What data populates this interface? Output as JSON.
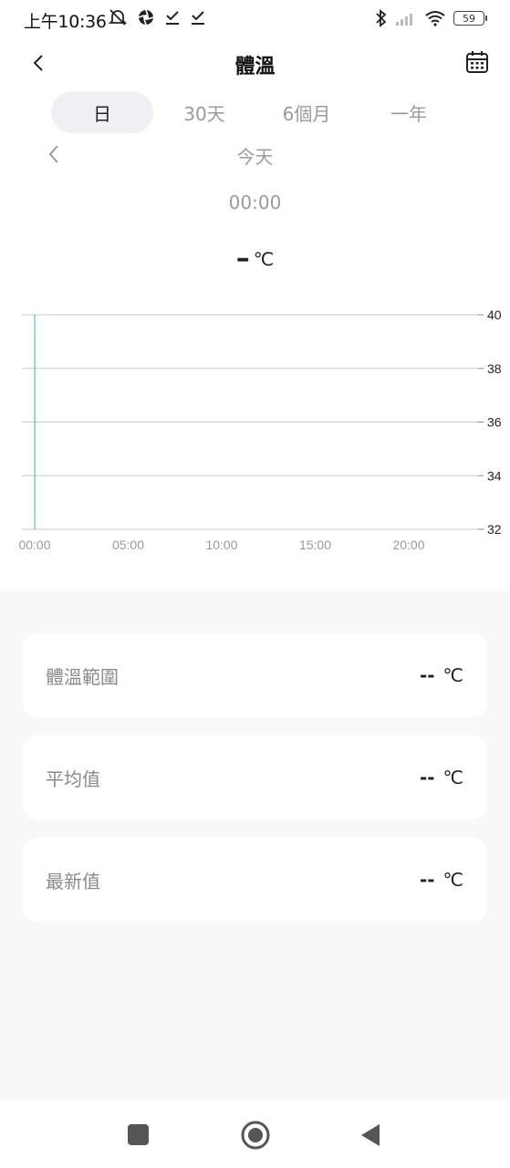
{
  "status_bar": {
    "time": "上午10:36",
    "battery": "59",
    "icons": [
      "mute-bell-icon",
      "aperture-icon",
      "check-download-icon",
      "check-download-icon",
      "bluetooth-icon",
      "signal-icon",
      "wifi-icon",
      "battery-icon"
    ]
  },
  "header": {
    "title": "體溫",
    "back_icon": "chevron-left-icon",
    "calendar_icon": "calendar-icon"
  },
  "tabs": [
    {
      "label": "日",
      "active": true
    },
    {
      "label": "30天",
      "active": false
    },
    {
      "label": "6個月",
      "active": false
    },
    {
      "label": "一年",
      "active": false
    }
  ],
  "date_nav": {
    "label": "今天",
    "prev_icon": "chevron-left-icon"
  },
  "selection": {
    "time": "00:00",
    "value": "–",
    "unit": "℃"
  },
  "chart_data": {
    "type": "line",
    "x_tick_labels": [
      "00:00",
      "05:00",
      "10:00",
      "15:00",
      "20:00"
    ],
    "y_tick_labels": [
      "40",
      "38",
      "36",
      "34",
      "32"
    ],
    "ylim": [
      32,
      40
    ],
    "xlim_hours": [
      0,
      24
    ],
    "series": [],
    "cursor_at": "00:00",
    "grid": true,
    "accent_color": "#4fc3c7"
  },
  "cards": [
    {
      "label": "體溫範圍",
      "value": "--",
      "unit": "℃"
    },
    {
      "label": "平均值",
      "value": "--",
      "unit": "℃"
    },
    {
      "label": "最新值",
      "value": "--",
      "unit": "℃"
    }
  ],
  "nav_bar": {
    "recents_icon": "square-icon",
    "home_icon": "circle-home-icon",
    "back_icon": "triangle-back-icon"
  }
}
